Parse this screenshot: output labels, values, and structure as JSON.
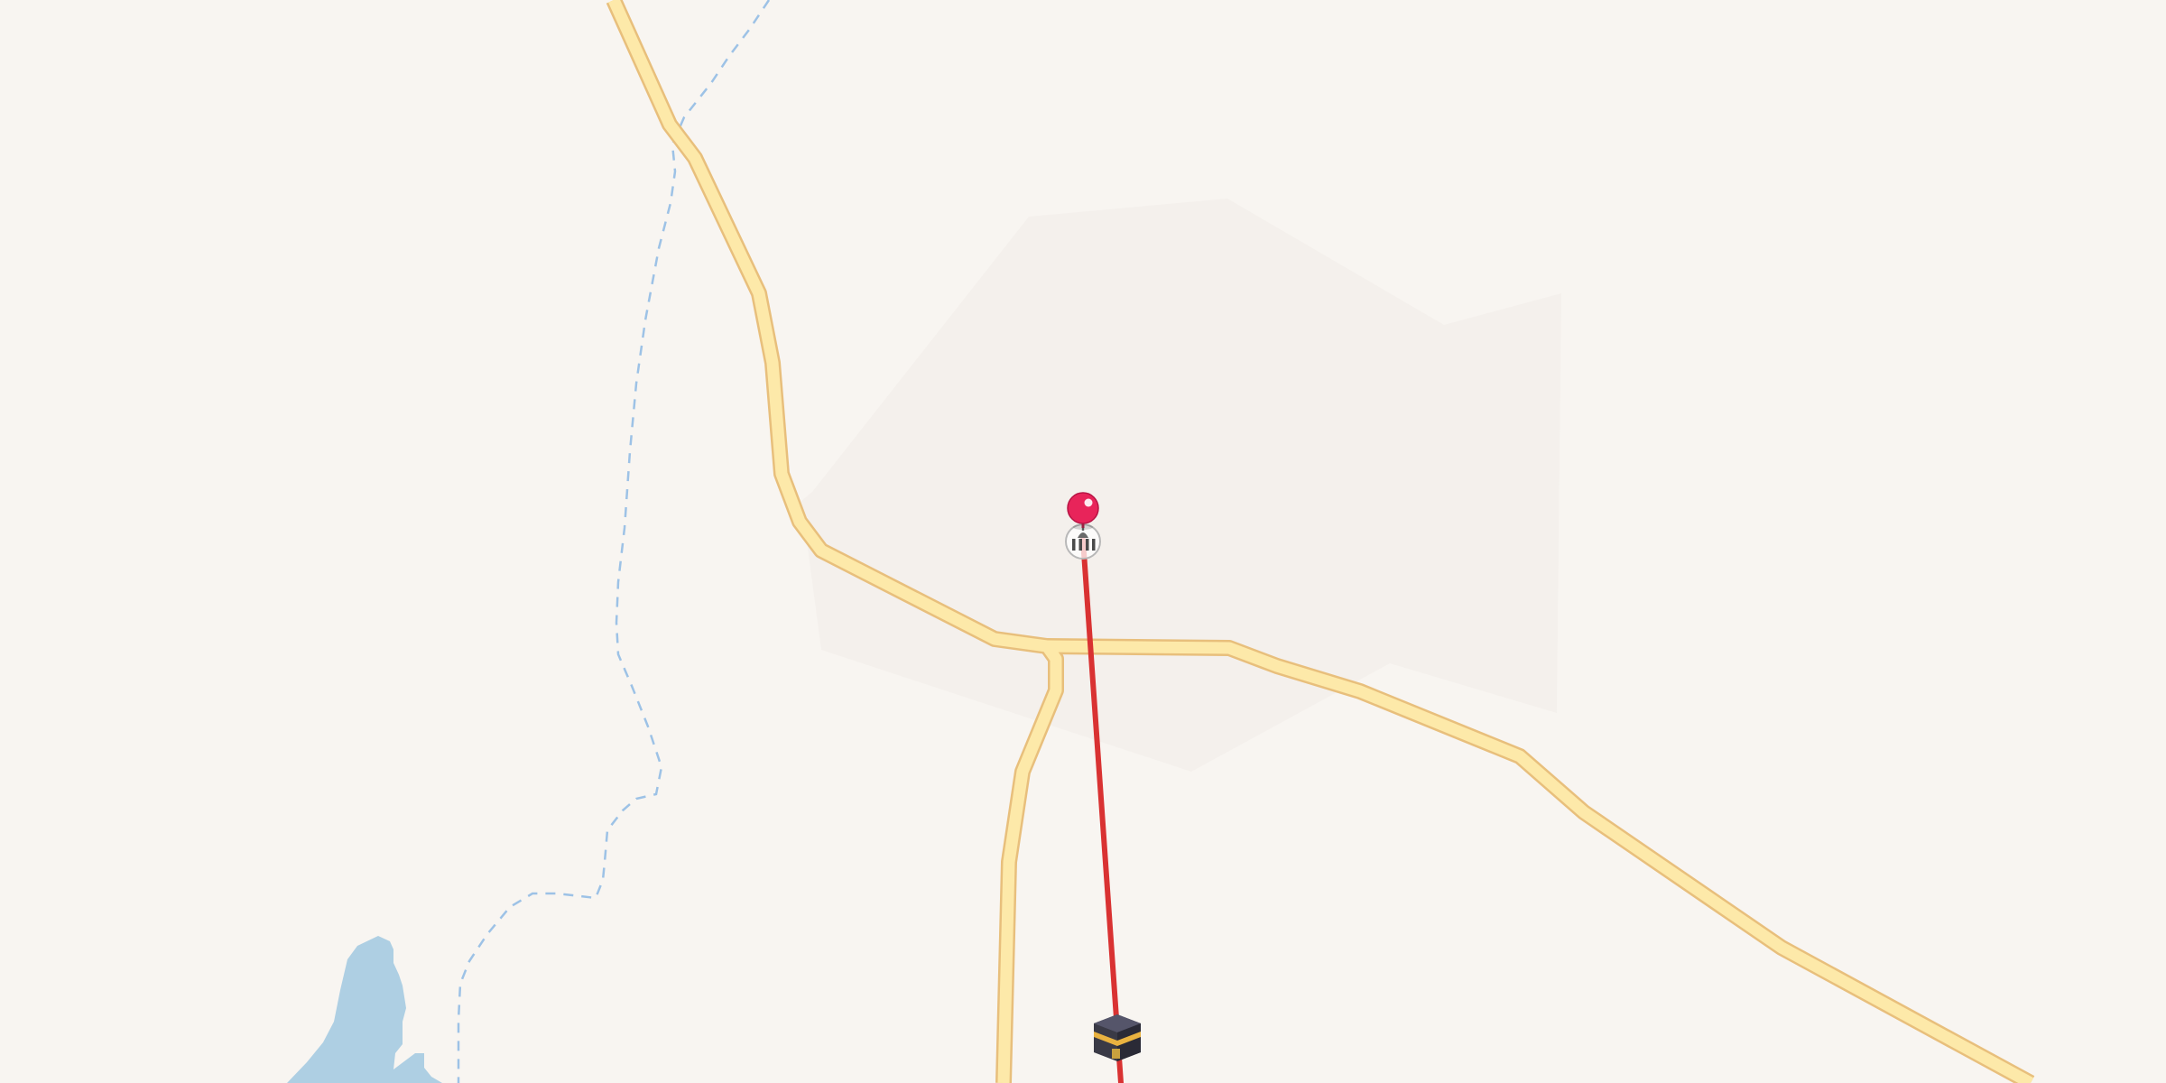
{
  "map": {
    "background_color": "#f8f5f1",
    "landuse_color": "#f4f0ec",
    "water_color": "#aecfe3",
    "road_fill_color": "#fde9a9",
    "road_casing_color": "#e8bf7c",
    "waterway_color": "#9dc2e6",
    "qibla_line_color": "#d93232"
  },
  "markers": {
    "location_pin": {
      "icon": "red-pin-icon",
      "color": "#e8245a"
    },
    "mosque": {
      "icon": "mosque-icon"
    },
    "kaaba": {
      "icon": "kaaba-icon",
      "color": "#3a3a46",
      "band_color": "#e9b240"
    }
  }
}
